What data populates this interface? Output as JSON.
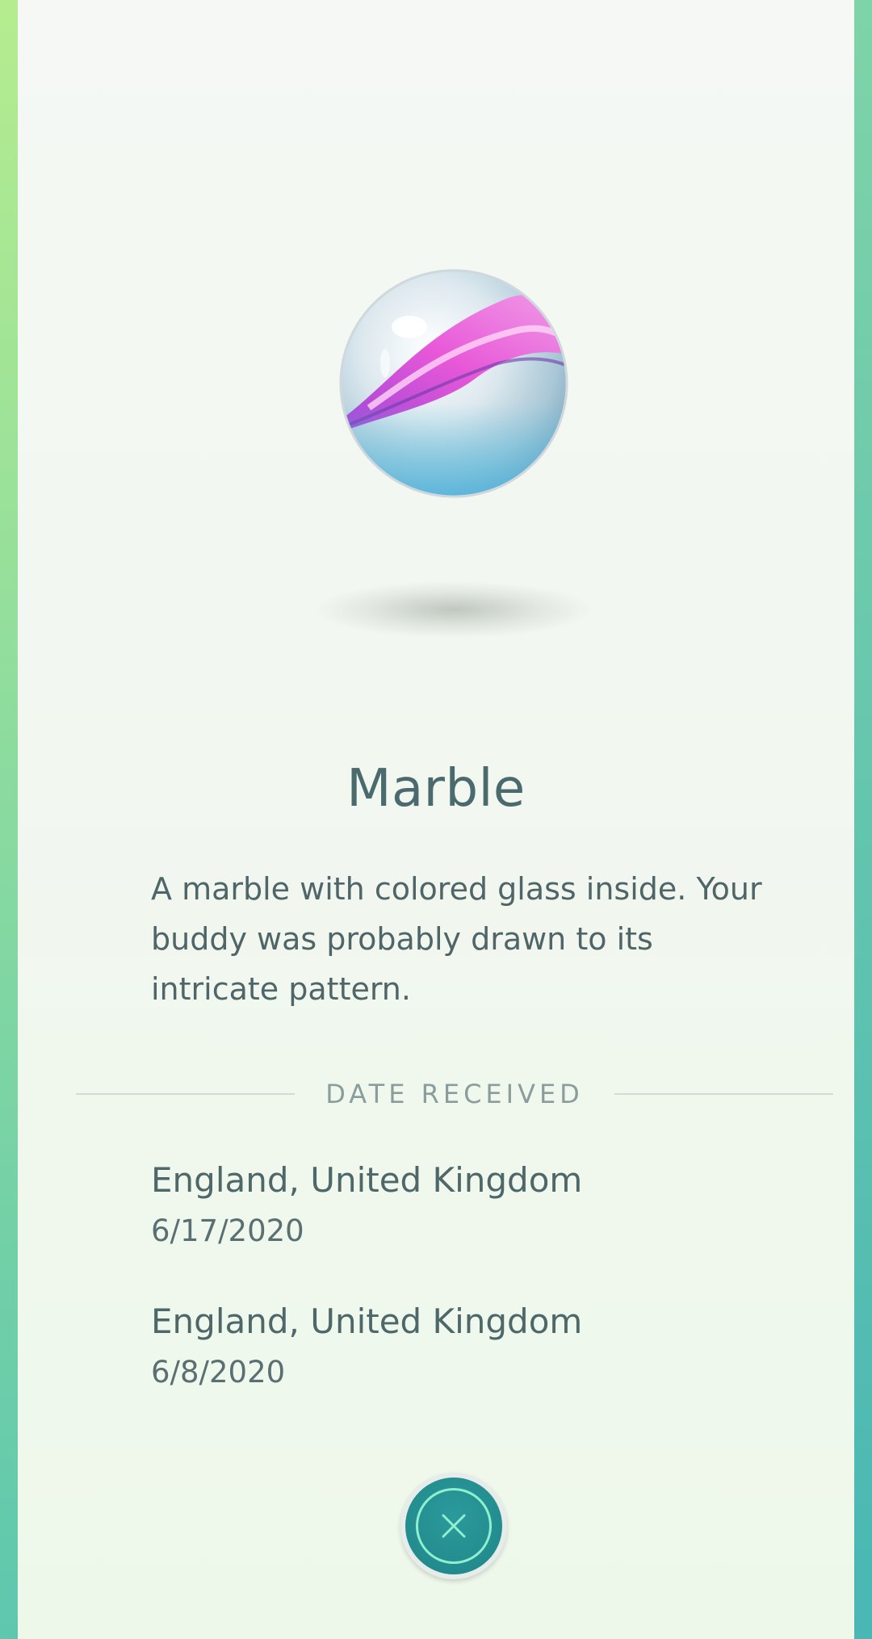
{
  "item": {
    "name": "Marble",
    "icon": "marble-icon",
    "description": "A marble with colored glass inside. Your buddy was probably drawn to its intricate pattern."
  },
  "history": {
    "section_label": "DATE RECEIVED",
    "entries": [
      {
        "location": "England, United Kingdom",
        "date": "6/17/2020"
      },
      {
        "location": "England, United Kingdom",
        "date": "6/8/2020"
      }
    ]
  },
  "close_button": {
    "icon": "close-icon"
  },
  "colors": {
    "title_text": "#4b6a6d",
    "accent_teal": "#1f8587",
    "ring": "#8ff0cf"
  }
}
